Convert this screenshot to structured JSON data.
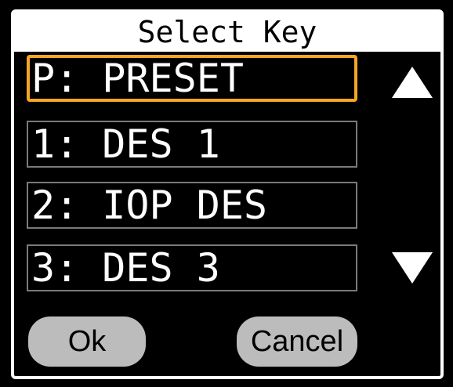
{
  "dialog": {
    "title": "Select Key"
  },
  "keys": [
    {
      "label": "P: PRESET",
      "selected": true
    },
    {
      "label": "1: DES 1",
      "selected": false
    },
    {
      "label": "2: IOP DES",
      "selected": false
    },
    {
      "label": "3: DES 3",
      "selected": false
    }
  ],
  "scroll": {
    "up_icon": "triangle-up",
    "down_icon": "triangle-down"
  },
  "buttons": {
    "ok_label": "Ok",
    "cancel_label": "Cancel"
  },
  "colors": {
    "background": "#000000",
    "title_bar": "#ffffff",
    "selection_highlight": "#f5a623",
    "item_border": "#7a7a7a",
    "button_fill": "#bcbcbc"
  }
}
